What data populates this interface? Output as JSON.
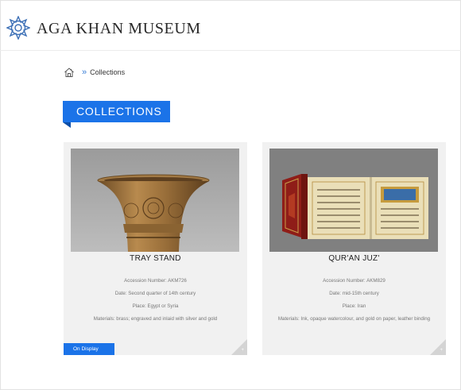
{
  "header": {
    "brand": "AGA KHAN MUSEUM",
    "logo_icon": "star-rosette-logo",
    "brand_color": "#3b6fb6"
  },
  "breadcrumb": {
    "home_icon": "home-icon",
    "separator": "»",
    "current": "Collections"
  },
  "section": {
    "title": "COLLECTIONS",
    "color": "#1b73e8"
  },
  "items": [
    {
      "title": "TRAY STAND",
      "accession": "Accession Number: AKM726",
      "date": "Date: Second quarter of 14th century",
      "place": "Place: Egypt or Syria",
      "materials": "Materials: brass; engraved and inlaid with silver and gold",
      "status": "On Display"
    },
    {
      "title": "QUR'AN JUZ'",
      "accession": "Accession Number: AKM829",
      "date": "Date: mid-15th century",
      "place": "Place: Iran",
      "materials": "Materials: Ink, opaque watercolour, and gold on paper, leather binding"
    }
  ]
}
